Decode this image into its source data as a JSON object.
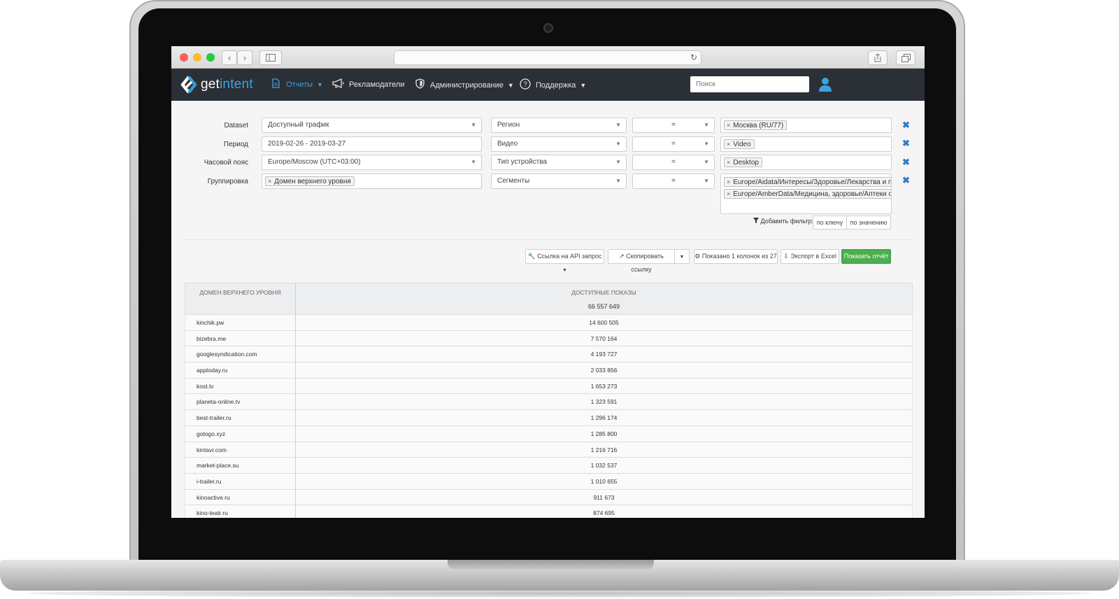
{
  "nav": {
    "logo_part1": "get",
    "logo_part2": "intent",
    "reports": "Отчеты",
    "advertisers": "Рекламодатели",
    "admin": "Администрирование",
    "support": "Поддержка",
    "search_placeholder": "Поиск"
  },
  "filters": {
    "labels": [
      "Dataset",
      "Период",
      "Часовой пояс",
      "Группировка"
    ],
    "dataset": "Доступный трафик",
    "period": "2019-02-26 - 2019-03-27",
    "timezone": "Europe/Moscow (UTC+03:00)",
    "grouping_tag": "Домен верхнего уровня",
    "rows": [
      {
        "key": "Регион",
        "op": "=",
        "values": [
          "Москва (RU/77)"
        ]
      },
      {
        "key": "Видео",
        "op": "=",
        "values": [
          "Video"
        ]
      },
      {
        "key": "Тип устройства",
        "op": "=",
        "values": [
          "Desktop"
        ]
      },
      {
        "key": "Сегменты",
        "op": "=",
        "values": [
          "Europe/Aidata/Интересы/Здоровье/Лекарства и пре",
          "Europe/AmberData/Медицина, здоровье/Аптеки онл"
        ]
      }
    ],
    "add_filter_label": "Добавить фильтр:",
    "by_key": "по ключу",
    "by_value": "по значению"
  },
  "actions": {
    "api_link": "Ссылка на API запрос",
    "copy_link": "Скопировать ссылку",
    "columns_shown": "Показано 1 колонок из 27",
    "export": "Экспорт в Excel",
    "show_report": "Показать отчёт"
  },
  "table": {
    "col1": "Домен верхнего уровня",
    "col2": "Доступные показы",
    "total": "66 557 649",
    "rows": [
      {
        "domain": "kinchik.pw",
        "value": "14 600 505"
      },
      {
        "domain": "bizebra.me",
        "value": "7 570 164"
      },
      {
        "domain": "googlesyndication.com",
        "value": "4 193 727"
      },
      {
        "domain": "apptoday.ru",
        "value": "2 033 856"
      },
      {
        "domain": "kost.tv",
        "value": "1 653 273"
      },
      {
        "domain": "planeta-online.tv",
        "value": "1 323 591"
      },
      {
        "domain": "best-trailer.ru",
        "value": "1 296 174"
      },
      {
        "domain": "gotogo.xyz",
        "value": "1 285 800"
      },
      {
        "domain": "kintavr.com",
        "value": "1 216 716"
      },
      {
        "domain": "market-place.su",
        "value": "1 032 537"
      },
      {
        "domain": "i-trailer.ru",
        "value": "1 010 655"
      },
      {
        "domain": "kinoactive.ru",
        "value": "911 673"
      },
      {
        "domain": "kino-teatr.ru",
        "value": "874 695"
      }
    ]
  },
  "colors": {
    "nav_bg": "#2b2f36",
    "accent": "#3aa3e3",
    "green_button": "#4cae4c",
    "remove_x": "#2e7cc4"
  }
}
